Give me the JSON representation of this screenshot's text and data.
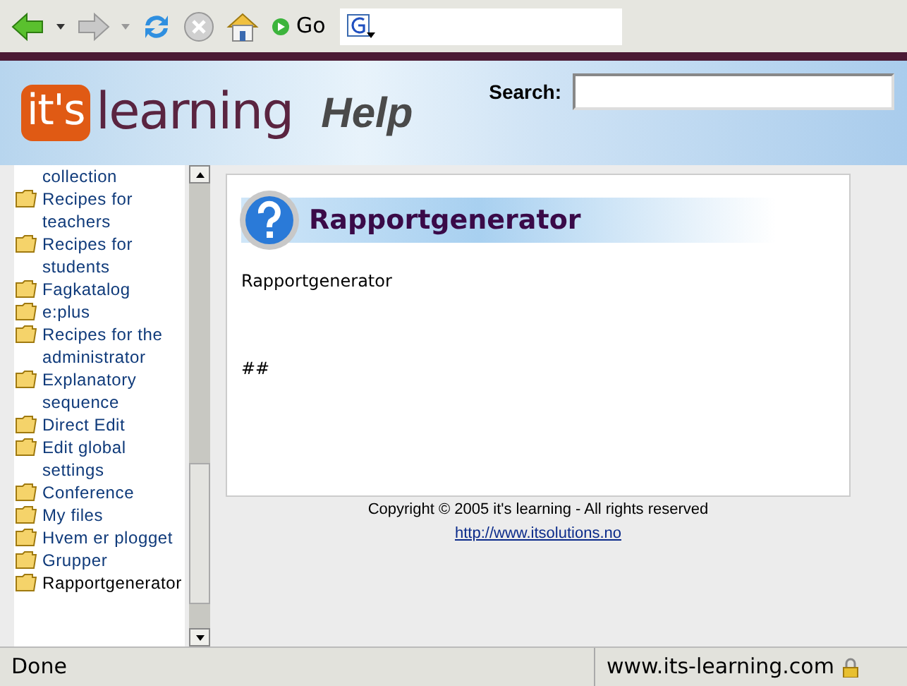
{
  "toolbar": {
    "go_label": "Go"
  },
  "header": {
    "logo_mark": "it's",
    "logo_word": "learning",
    "title": "Help",
    "search_label": "Search:"
  },
  "sidebar": {
    "items": [
      {
        "label": "collection",
        "kind": "continuation",
        "selected": false
      },
      {
        "label": "Recipes for teachers",
        "kind": "folder",
        "selected": false
      },
      {
        "label": "Recipes for students",
        "kind": "folder",
        "selected": false
      },
      {
        "label": "Fagkatalog",
        "kind": "folder",
        "selected": false
      },
      {
        "label": "e:plus",
        "kind": "folder",
        "selected": false
      },
      {
        "label": "Recipes for the administrator",
        "kind": "folder",
        "selected": false
      },
      {
        "label": "Explanatory sequence",
        "kind": "folder",
        "selected": false
      },
      {
        "label": "Direct Edit",
        "kind": "folder",
        "selected": false
      },
      {
        "label": "Edit global settings",
        "kind": "folder",
        "selected": false
      },
      {
        "label": "Conference",
        "kind": "folder",
        "selected": false
      },
      {
        "label": "My files",
        "kind": "folder",
        "selected": false
      },
      {
        "label": "Hvem er plogget",
        "kind": "folder",
        "selected": false
      },
      {
        "label": "Grupper",
        "kind": "folder",
        "selected": false
      },
      {
        "label": "Rapportgenerator",
        "kind": "folder",
        "selected": true
      }
    ]
  },
  "article": {
    "heading": "Rapportgenerator",
    "paragraphs": [
      "Rapportgenerator",
      "##"
    ]
  },
  "footer": {
    "copyright": "Copyright © 2005 it's learning - All rights reserved",
    "link": "http://www.itsolutions.no"
  },
  "status_bar": {
    "status": "Done",
    "site": "www.its-learning.com"
  }
}
